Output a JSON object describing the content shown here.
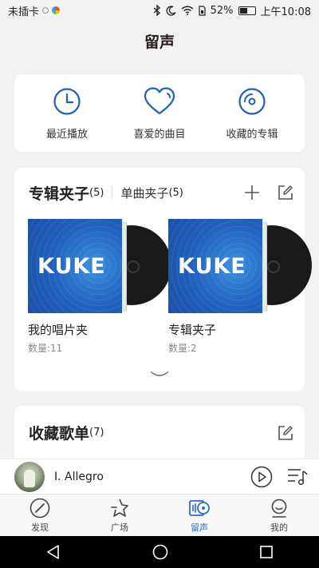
{
  "status_bar": {
    "carrier": "未插卡",
    "battery": "52%",
    "time": "上午10:08"
  },
  "page_title": "留声",
  "quick_access": [
    {
      "label": "最近播放",
      "icon": "clock-icon"
    },
    {
      "label": "喜爱的曲目",
      "icon": "heart-icon"
    },
    {
      "label": "收藏的专辑",
      "icon": "disc-icon"
    }
  ],
  "folders": {
    "active_tab": {
      "label": "专辑夹子",
      "count": "(5)"
    },
    "inactive_tab": {
      "label": "单曲夹子",
      "count": "(5)"
    },
    "items": [
      {
        "name": "我的唱片夹",
        "count": "数量:11",
        "cover_text": "KUKE"
      },
      {
        "name": "专辑夹子",
        "count": "数量:2",
        "cover_text": "KUKE"
      }
    ]
  },
  "playlists": {
    "label": "收藏歌单",
    "count": "(7)"
  },
  "player": {
    "song": "I. Allegro"
  },
  "tabs": [
    {
      "label": "发现",
      "icon": "compass-icon"
    },
    {
      "label": "广场",
      "icon": "plaza-icon"
    },
    {
      "label": "留声",
      "icon": "gramophone-icon",
      "active": true
    },
    {
      "label": "我的",
      "icon": "user-icon"
    }
  ],
  "colors": {
    "accent": "#2a6fcf",
    "icon_blue": "#2160b8",
    "cover_blue": "#2162c0"
  }
}
